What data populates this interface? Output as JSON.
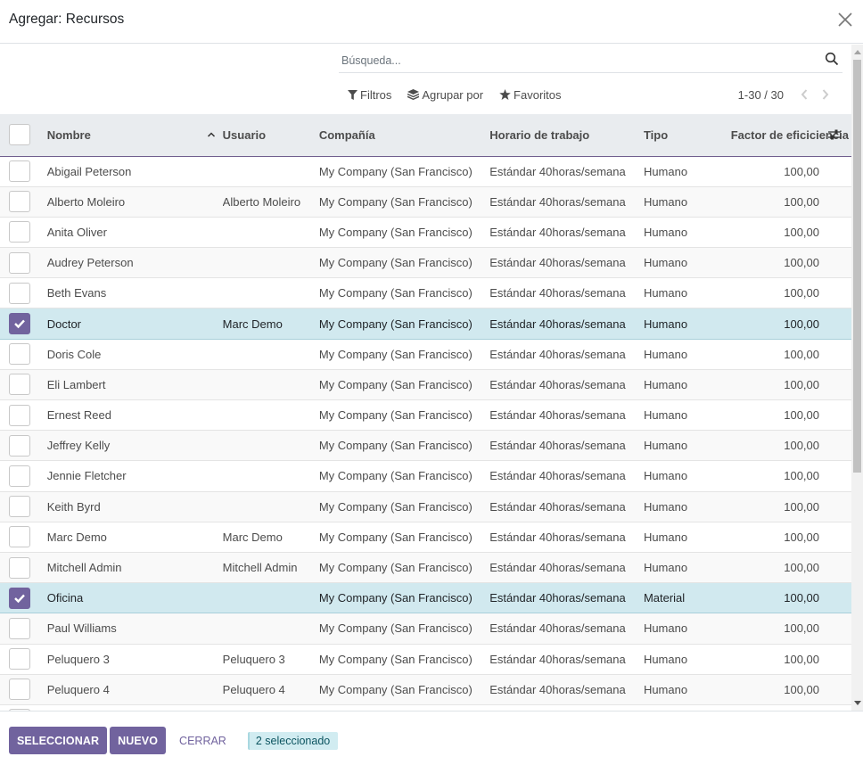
{
  "dialog": {
    "title": "Agregar: Recursos",
    "close_icon": "close-icon"
  },
  "search": {
    "placeholder": "Búsqueda...",
    "value": "",
    "icon": "search-icon"
  },
  "search_options": {
    "filters_label": "Filtros",
    "groupby_label": "Agrupar por",
    "favorites_label": "Favoritos"
  },
  "pager": {
    "value": "1-30 / 30",
    "prev_icon": "chevron-left-icon",
    "next_icon": "chevron-right-icon"
  },
  "table": {
    "columns": [
      "Nombre",
      "Usuario",
      "Compañía",
      "Horario de trabajo",
      "Tipo",
      "Factor de eficiciencia"
    ],
    "sort": {
      "column": "Nombre",
      "direction": "ascending"
    },
    "rows": [
      {
        "name": "Abigail Peterson",
        "user": "",
        "company": "My Company (San Francisco)",
        "schedule": "Estándar 40horas/semana",
        "type": "Humano",
        "factor": "100,00",
        "selected": false
      },
      {
        "name": "Alberto Moleiro",
        "user": "Alberto Moleiro",
        "company": "My Company (San Francisco)",
        "schedule": "Estándar 40horas/semana",
        "type": "Humano",
        "factor": "100,00",
        "selected": false
      },
      {
        "name": "Anita Oliver",
        "user": "",
        "company": "My Company (San Francisco)",
        "schedule": "Estándar 40horas/semana",
        "type": "Humano",
        "factor": "100,00",
        "selected": false
      },
      {
        "name": "Audrey Peterson",
        "user": "",
        "company": "My Company (San Francisco)",
        "schedule": "Estándar 40horas/semana",
        "type": "Humano",
        "factor": "100,00",
        "selected": false
      },
      {
        "name": "Beth Evans",
        "user": "",
        "company": "My Company (San Francisco)",
        "schedule": "Estándar 40horas/semana",
        "type": "Humano",
        "factor": "100,00",
        "selected": false
      },
      {
        "name": "Doctor",
        "user": "Marc Demo",
        "company": "My Company (San Francisco)",
        "schedule": "Estándar 40horas/semana",
        "type": "Humano",
        "factor": "100,00",
        "selected": true
      },
      {
        "name": "Doris Cole",
        "user": "",
        "company": "My Company (San Francisco)",
        "schedule": "Estándar 40horas/semana",
        "type": "Humano",
        "factor": "100,00",
        "selected": false
      },
      {
        "name": "Eli Lambert",
        "user": "",
        "company": "My Company (San Francisco)",
        "schedule": "Estándar 40horas/semana",
        "type": "Humano",
        "factor": "100,00",
        "selected": false
      },
      {
        "name": "Ernest Reed",
        "user": "",
        "company": "My Company (San Francisco)",
        "schedule": "Estándar 40horas/semana",
        "type": "Humano",
        "factor": "100,00",
        "selected": false
      },
      {
        "name": "Jeffrey Kelly",
        "user": "",
        "company": "My Company (San Francisco)",
        "schedule": "Estándar 40horas/semana",
        "type": "Humano",
        "factor": "100,00",
        "selected": false
      },
      {
        "name": "Jennie Fletcher",
        "user": "",
        "company": "My Company (San Francisco)",
        "schedule": "Estándar 40horas/semana",
        "type": "Humano",
        "factor": "100,00",
        "selected": false
      },
      {
        "name": "Keith Byrd",
        "user": "",
        "company": "My Company (San Francisco)",
        "schedule": "Estándar 40horas/semana",
        "type": "Humano",
        "factor": "100,00",
        "selected": false
      },
      {
        "name": "Marc Demo",
        "user": "Marc Demo",
        "company": "My Company (San Francisco)",
        "schedule": "Estándar 40horas/semana",
        "type": "Humano",
        "factor": "100,00",
        "selected": false
      },
      {
        "name": "Mitchell Admin",
        "user": "Mitchell Admin",
        "company": "My Company (San Francisco)",
        "schedule": "Estándar 40horas/semana",
        "type": "Humano",
        "factor": "100,00",
        "selected": false
      },
      {
        "name": "Oficina",
        "user": "",
        "company": "My Company (San Francisco)",
        "schedule": "Estándar 40horas/semana",
        "type": "Material",
        "factor": "100,00",
        "selected": true
      },
      {
        "name": "Paul Williams",
        "user": "",
        "company": "My Company (San Francisco)",
        "schedule": "Estándar 40horas/semana",
        "type": "Humano",
        "factor": "100,00",
        "selected": false
      },
      {
        "name": "Peluquero 3",
        "user": "Peluquero 3",
        "company": "My Company (San Francisco)",
        "schedule": "Estándar 40horas/semana",
        "type": "Humano",
        "factor": "100,00",
        "selected": false
      },
      {
        "name": "Peluquero 4",
        "user": "Peluquero 4",
        "company": "My Company (San Francisco)",
        "schedule": "Estándar 40horas/semana",
        "type": "Humano",
        "factor": "100,00",
        "selected": false
      },
      {
        "name": "",
        "user": "",
        "company": "",
        "schedule": "",
        "type": "",
        "factor": "",
        "selected": false
      }
    ]
  },
  "footer": {
    "select_label": "SELECCIONAR",
    "new_label": "NUEVO",
    "close_label": "CERRAR",
    "selection_badge": "2 seleccionado"
  },
  "colors": {
    "primary": "#71639e",
    "selected_row": "#d1e9ef",
    "header_bg": "#e9ecef",
    "badge_bg": "#d1ecf1"
  }
}
